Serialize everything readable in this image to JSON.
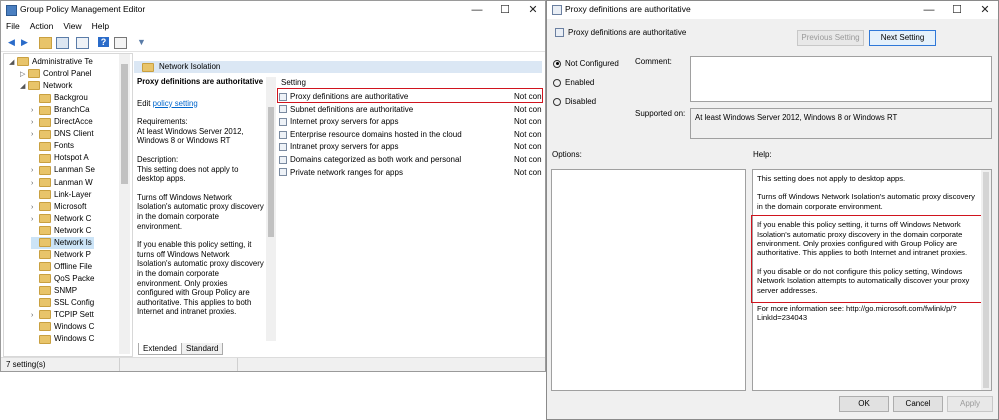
{
  "gpme": {
    "title": "Group Policy Management Editor",
    "menu": [
      "File",
      "Action",
      "View",
      "Help"
    ],
    "tree": [
      {
        "label": "Administrative Te",
        "indent": 1,
        "expanded": true
      },
      {
        "label": "Control Panel",
        "indent": 2,
        "expanded": false
      },
      {
        "label": "Network",
        "indent": 2,
        "expanded": true
      },
      {
        "label": "Backgrou",
        "indent": 3
      },
      {
        "label": "BranchCa",
        "indent": 3
      },
      {
        "label": "DirectAcce",
        "indent": 3
      },
      {
        "label": "DNS Client",
        "indent": 3
      },
      {
        "label": "Fonts",
        "indent": 3
      },
      {
        "label": "Hotspot A",
        "indent": 3
      },
      {
        "label": "Lanman Se",
        "indent": 3
      },
      {
        "label": "Lanman W",
        "indent": 3
      },
      {
        "label": "Link-Layer",
        "indent": 3
      },
      {
        "label": "Microsoft",
        "indent": 3
      },
      {
        "label": "Network C",
        "indent": 3
      },
      {
        "label": "Network C",
        "indent": 3
      },
      {
        "label": "Network Is",
        "indent": 3,
        "selected": true
      },
      {
        "label": "Network P",
        "indent": 3
      },
      {
        "label": "Offline File",
        "indent": 3
      },
      {
        "label": "QoS Packe",
        "indent": 3
      },
      {
        "label": "SNMP",
        "indent": 3
      },
      {
        "label": "SSL Config",
        "indent": 3
      },
      {
        "label": "TCPIP Sett",
        "indent": 3
      },
      {
        "label": "Windows C",
        "indent": 3
      },
      {
        "label": "Windows C",
        "indent": 3
      }
    ],
    "header": "Network Isolation",
    "description": {
      "title": "Proxy definitions are authoritative",
      "edit_prefix": "Edit",
      "edit_link": "policy setting",
      "requirements": "Requirements:",
      "requirements_text": "At least Windows Server 2012, Windows 8 or Windows RT",
      "description_label": "Description:",
      "p1": "This setting does not apply to desktop apps.",
      "p2": "Turns off Windows Network Isolation's automatic proxy discovery in the domain corporate environment.",
      "p3": "If you enable this policy setting, it turns off Windows Network Isolation's automatic proxy discovery in the domain corporate environment. Only proxies configured with Group Policy are authoritative. This applies to both Internet and intranet proxies."
    },
    "columns": {
      "setting": "Setting"
    },
    "settings": [
      {
        "name": "Proxy definitions are authoritative",
        "state": "Not con"
      },
      {
        "name": "Subnet definitions are authoritative",
        "state": "Not con"
      },
      {
        "name": "Internet proxy servers for apps",
        "state": "Not con"
      },
      {
        "name": "Enterprise resource domains hosted in the cloud",
        "state": "Not con"
      },
      {
        "name": "Intranet proxy servers for  apps",
        "state": "Not con"
      },
      {
        "name": "Domains categorized as both work and personal",
        "state": "Not con"
      },
      {
        "name": "Private network ranges for  apps",
        "state": "Not con"
      }
    ],
    "tabs": [
      "Extended",
      "Standard"
    ],
    "status": "7 setting(s)",
    "highlight_color": "#d0141e"
  },
  "dialog": {
    "title": "Proxy definitions are authoritative",
    "setting_name": "Proxy definitions are authoritative",
    "prev_button": "Previous Setting",
    "next_button": "Next Setting",
    "options": [
      "Not Configured",
      "Enabled",
      "Disabled"
    ],
    "selected_option": "Not Configured",
    "comment_label": "Comment:",
    "supported_label": "Supported on:",
    "supported_text": "At least Windows Server 2012, Windows 8 or Windows RT",
    "options_label": "Options:",
    "help_label": "Help:",
    "help": {
      "p1": "This setting does not apply to desktop apps.",
      "p2": "Turns off Windows Network Isolation's automatic proxy discovery in the domain corporate environment.",
      "p3": "If you enable this policy setting, it turns off Windows Network Isolation's automatic proxy discovery in the domain corporate environment. Only proxies configured with Group Policy are authoritative. This applies to both Internet and intranet proxies.",
      "p4": "If you disable or do not configure this policy setting, Windows Network Isolation attempts to automatically discover your proxy server addresses.",
      "p5": "For more information see: http://go.microsoft.com/fwlink/p/?LinkId=234043"
    },
    "ok": "OK",
    "cancel": "Cancel",
    "apply": "Apply"
  }
}
